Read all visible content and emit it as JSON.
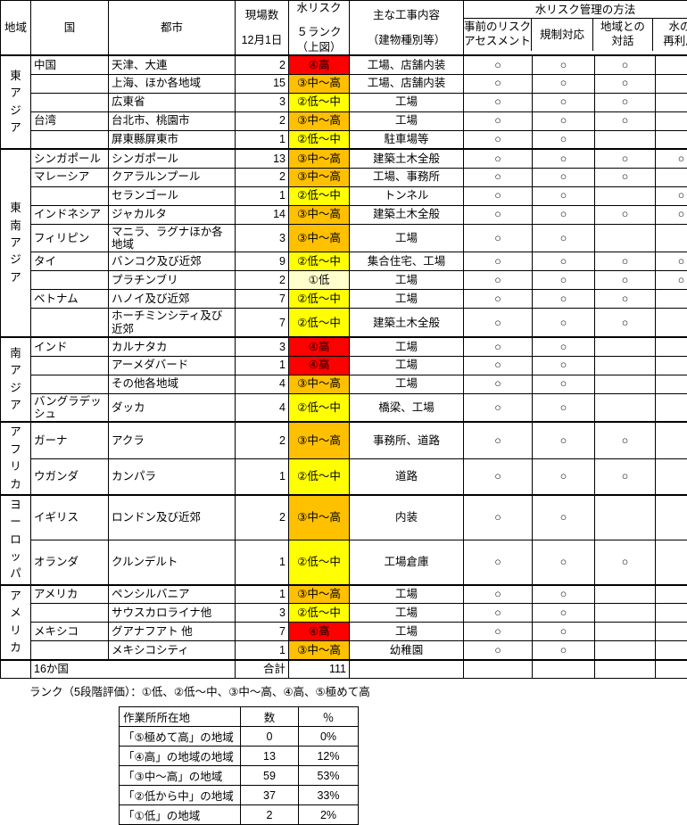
{
  "header": {
    "region": "地域",
    "country": "国",
    "city": "都市",
    "sites": "現場数",
    "sites_sub": "12月1日",
    "risk": "水リスク",
    "risk_sub1": "５ランク",
    "risk_sub2": "（上図）",
    "work": "主な工事内容",
    "work_sub": "（建物種別等）",
    "management": "水リスク管理の方法",
    "m1_a": "事前のリスク",
    "m1_b": "アセスメント",
    "m2": "規制対応",
    "m3_a": "地域との",
    "m3_b": "対話",
    "m4_a": "水の",
    "m4_b": "再利用"
  },
  "mark": "○",
  "groups": [
    {
      "region": "東アジア",
      "rows": [
        {
          "country": "中国",
          "city": "天津、大連",
          "sites": "2",
          "risk": "④高",
          "risk_class": "r4",
          "work": "工場、店舗内装",
          "marks": [
            true,
            true,
            true,
            false
          ]
        },
        {
          "country": "",
          "city": "上海、ほか各地域",
          "sites": "15",
          "risk": "③中〜高",
          "risk_class": "r3",
          "work": "工場、店舗内装",
          "marks": [
            true,
            true,
            true,
            false
          ]
        },
        {
          "country": "",
          "city": "広東省",
          "sites": "3",
          "risk": "②低〜中",
          "risk_class": "r2",
          "work": "工場",
          "marks": [
            true,
            true,
            true,
            false
          ]
        },
        {
          "country": "台湾",
          "city": "台北市、桃園市",
          "sites": "2",
          "risk": "③中〜高",
          "risk_class": "r3",
          "work": "工場",
          "marks": [
            true,
            true,
            true,
            false
          ],
          "country_top": true
        },
        {
          "country": "",
          "city": "屏東縣屏東市",
          "sites": "1",
          "risk": "②低〜中",
          "risk_class": "r2",
          "work": "駐車場等",
          "marks": [
            true,
            true,
            false,
            false
          ]
        }
      ]
    },
    {
      "region": "東南アジア",
      "rows": [
        {
          "country": "シンガポール",
          "city": "シンガポール",
          "sites": "13",
          "risk": "③中〜高",
          "risk_class": "r3",
          "work": "建築土木全般",
          "marks": [
            true,
            true,
            true,
            true
          ]
        },
        {
          "country": "マレーシア",
          "city": "クアラルンプール",
          "sites": "2",
          "risk": "③中〜高",
          "risk_class": "r3",
          "work": "工場、事務所",
          "marks": [
            true,
            true,
            true,
            false
          ],
          "country_top": true
        },
        {
          "country": "",
          "city": "セランゴール",
          "sites": "1",
          "risk": "②低〜中",
          "risk_class": "r2",
          "work": "トンネル",
          "marks": [
            true,
            true,
            false,
            true
          ]
        },
        {
          "country": "インドネシア",
          "city": "ジャカルタ",
          "sites": "14",
          "risk": "③中〜高",
          "risk_class": "r3",
          "work": "建築土木全般",
          "marks": [
            true,
            true,
            true,
            true
          ],
          "country_top": true
        },
        {
          "country": "フィリピン",
          "city": "マニラ、ラグナほか各地域",
          "sites": "3",
          "risk": "③中〜高",
          "risk_class": "r3",
          "work": "工場",
          "marks": [
            true,
            true,
            false,
            false
          ],
          "country_top": true
        },
        {
          "country": "タイ",
          "city": "バンコク及び近郊",
          "sites": "9",
          "risk": "②低〜中",
          "risk_class": "r2",
          "work": "集合住宅、工場",
          "marks": [
            true,
            true,
            true,
            true
          ],
          "country_top": true
        },
        {
          "country": "",
          "city": "プラチンブリ",
          "sites": "2",
          "risk": "①低",
          "risk_class": "r1",
          "work": "工場",
          "marks": [
            true,
            true,
            true,
            true
          ]
        },
        {
          "country": "ベトナム",
          "city": "ハノイ及び近郊",
          "sites": "7",
          "risk": "②低〜中",
          "risk_class": "r2",
          "work": "工場",
          "marks": [
            true,
            true,
            true,
            false
          ],
          "country_top": true
        },
        {
          "country": "",
          "city": "ホーチミンシティ及び近郊",
          "sites": "7",
          "risk": "②低〜中",
          "risk_class": "r2",
          "work": "建築土木全般",
          "marks": [
            true,
            true,
            true,
            false
          ]
        }
      ]
    },
    {
      "region": "南アジア",
      "rows": [
        {
          "country": "インド",
          "city": "カルナタカ",
          "sites": "3",
          "risk": "④高",
          "risk_class": "r4",
          "work": "工場",
          "marks": [
            true,
            true,
            false,
            false
          ]
        },
        {
          "country": "",
          "city": "アーメダバード",
          "sites": "1",
          "risk": "④高",
          "risk_class": "r4",
          "work": "工場",
          "marks": [
            true,
            true,
            false,
            false
          ]
        },
        {
          "country": "",
          "city": "その他各地域",
          "sites": "4",
          "risk": "③中〜高",
          "risk_class": "r3",
          "work": "工場",
          "marks": [
            true,
            true,
            false,
            false
          ]
        },
        {
          "country": "バングラデッシュ",
          "city": "ダッカ",
          "sites": "4",
          "risk": "②低〜中",
          "risk_class": "r2",
          "work": "橋梁、工場",
          "marks": [
            true,
            true,
            false,
            false
          ],
          "country_top": true
        }
      ]
    },
    {
      "region": "アフリカ",
      "rows": [
        {
          "country": "ガーナ",
          "city": "アクラ",
          "sites": "2",
          "risk": "③中〜高",
          "risk_class": "r3",
          "work": "事務所、道路",
          "marks": [
            true,
            true,
            true,
            false
          ]
        },
        {
          "country": "ウガンダ",
          "city": "カンパラ",
          "sites": "1",
          "risk": "②低〜中",
          "risk_class": "r2",
          "work": "道路",
          "marks": [
            true,
            true,
            true,
            false
          ],
          "country_top": true
        }
      ]
    },
    {
      "region": "ヨーロッパ",
      "rows": [
        {
          "country": "イギリス",
          "city": "ロンドン及び近郊",
          "sites": "2",
          "risk": "③中〜高",
          "risk_class": "r3",
          "work": "内装",
          "marks": [
            true,
            true,
            false,
            false
          ]
        },
        {
          "country": "オランダ",
          "city": "クルンデルト",
          "sites": "1",
          "risk": "②低〜中",
          "risk_class": "r2",
          "work": "工場倉庫",
          "marks": [
            true,
            true,
            true,
            false
          ],
          "country_top": true
        }
      ]
    },
    {
      "region": "アメリカ",
      "rows": [
        {
          "country": "アメリカ",
          "city": "ペンシルバニア",
          "sites": "1",
          "risk": "③中〜高",
          "risk_class": "r3",
          "work": "工場",
          "marks": [
            true,
            true,
            false,
            false
          ]
        },
        {
          "country": "",
          "city": "サウスカロライナ他",
          "sites": "3",
          "risk": "②低〜中",
          "risk_class": "r2",
          "work": "工場",
          "marks": [
            true,
            true,
            false,
            false
          ]
        },
        {
          "country": "メキシコ",
          "city": "グアナフアト 他",
          "sites": "7",
          "risk": "④高",
          "risk_class": "r4",
          "work": "工場",
          "marks": [
            true,
            true,
            false,
            false
          ],
          "country_top": true
        },
        {
          "country": "",
          "city": "メキシコシティ",
          "sites": "1",
          "risk": "③中〜高",
          "risk_class": "r3",
          "work": "幼稚園",
          "marks": [
            true,
            true,
            false,
            false
          ]
        }
      ]
    }
  ],
  "total": {
    "countries": "16か国",
    "label": "合計",
    "value": "111"
  },
  "note": "ランク（5段階評価）：①低、②低〜中、③中〜高、④高、⑤極めて高",
  "summary": {
    "headers": [
      "作業所所在地",
      "数",
      "％"
    ],
    "rows": [
      {
        "location": "「⑤極めて高」の地域",
        "count": "0",
        "percent": "0%"
      },
      {
        "location": "「④高」の地域の地域",
        "count": "13",
        "percent": "12%"
      },
      {
        "location": "「③中〜高」の地域",
        "count": "59",
        "percent": "53%"
      },
      {
        "location": "「②低から中」の地域",
        "count": "37",
        "percent": "33%"
      },
      {
        "location": "「①低」の地域",
        "count": "2",
        "percent": "2%"
      }
    ]
  }
}
